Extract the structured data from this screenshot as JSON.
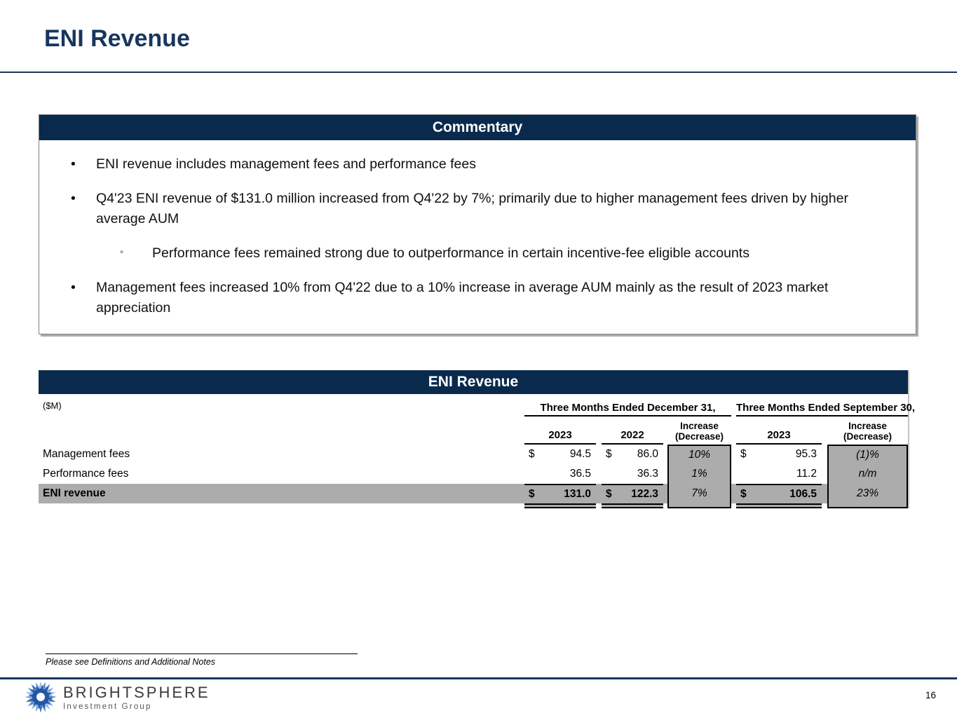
{
  "page": {
    "title": "ENI Revenue",
    "page_number": "16"
  },
  "commentary": {
    "header": "Commentary",
    "bullets": [
      {
        "level": 1,
        "text": "ENI revenue includes management fees and performance fees"
      },
      {
        "level": 1,
        "text": "Q4'23 ENI revenue of $131.0 million increased from Q4'22 by 7%; primarily due to higher management fees driven by higher average AUM"
      },
      {
        "level": 2,
        "text": "Performance fees remained strong due to outperformance in certain incentive-fee eligible accounts"
      },
      {
        "level": 1,
        "text": "Management fees increased 10% from Q4'22 due to a 10% increase in average AUM mainly as the result of 2023 market appreciation"
      }
    ]
  },
  "table": {
    "title": "ENI Revenue",
    "units_label": "($M)",
    "group_headers": {
      "december": "Three Months Ended December 31,",
      "september": "Three Months Ended September 30,"
    },
    "col_headers": {
      "dec_2023": "2023",
      "dec_2022": "2022",
      "sep_2023": "2023",
      "increase_line1": "Increase",
      "increase_line2": "(Decrease)"
    },
    "rows": [
      {
        "label": "Management fees",
        "dec23_cur": "$",
        "dec23": "94.5",
        "dec22_cur": "$",
        "dec22": "86.0",
        "inc_dec": "10%",
        "sep23_cur": "$",
        "sep23": "95.3",
        "inc_sep": "(1)%"
      },
      {
        "label": "Performance fees",
        "dec23_cur": "",
        "dec23": "36.5",
        "dec22_cur": "",
        "dec22": "36.3",
        "inc_dec": "1%",
        "sep23_cur": "",
        "sep23": "11.2",
        "inc_sep": "n/m"
      },
      {
        "label": "ENI revenue",
        "dec23_cur": "$",
        "dec23": "131.0",
        "dec22_cur": "$",
        "dec22": "122.3",
        "inc_dec": "7%",
        "sep23_cur": "$",
        "sep23": "106.5",
        "inc_sep": "23%"
      }
    ]
  },
  "footer": {
    "footnote": "Please see Definitions and Additional Notes",
    "logo_title": "BRIGHTSPHERE",
    "logo_subtitle": "Investment Group"
  },
  "colors": {
    "navy": "#0A2A4D",
    "accent_rule": "#17375E",
    "shaded_gray": "#ACACAC"
  },
  "icons": {
    "bullet": "•",
    "sub_bullet": "◦",
    "logo": "brightsphere-starburst-icon"
  }
}
